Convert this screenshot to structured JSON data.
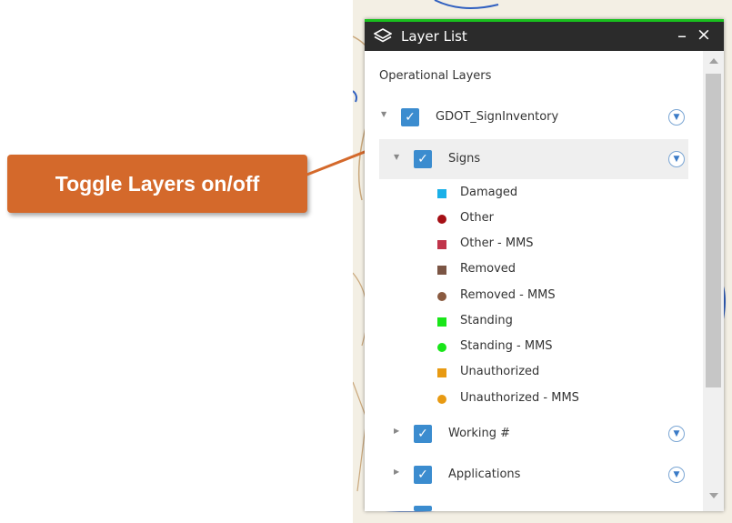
{
  "callout": {
    "text": "Toggle Layers on/off"
  },
  "panel": {
    "title": "Layer List",
    "minimize_label": "–",
    "close_label": "×",
    "section_title": "Operational Layers"
  },
  "layers": [
    {
      "label": "GDOT_SignInventory",
      "checked": true,
      "expanded": true
    },
    {
      "label": "Signs",
      "checked": true,
      "expanded": true,
      "selected": true
    },
    {
      "label": "Working #",
      "checked": true,
      "expanded": false
    },
    {
      "label": "Applications",
      "checked": true,
      "expanded": false
    }
  ],
  "legend": [
    {
      "label": "Damaged",
      "color": "#1ab0e8",
      "shape": "square"
    },
    {
      "label": "Other",
      "color": "#a50f15",
      "shape": "circle"
    },
    {
      "label": "Other - MMS",
      "color": "#c0344a",
      "shape": "square"
    },
    {
      "label": "Removed",
      "color": "#7b5544",
      "shape": "square"
    },
    {
      "label": "Removed - MMS",
      "color": "#8a5a40",
      "shape": "circle"
    },
    {
      "label": "Standing",
      "color": "#19e619",
      "shape": "square"
    },
    {
      "label": "Standing - MMS",
      "color": "#19e619",
      "shape": "circle"
    },
    {
      "label": "Unauthorized",
      "color": "#e89a12",
      "shape": "square"
    },
    {
      "label": "Unauthorized - MMS",
      "color": "#e89a12",
      "shape": "circle"
    }
  ],
  "colors": {
    "callout_bg": "#d4692b",
    "header_bg": "#2b2b2b",
    "accent_green": "#19c01e",
    "checkbox_blue": "#3b8ccf",
    "arrow": "#d4692b"
  },
  "icons": {
    "layers": "layers-icon",
    "checkbox": "checkmark-icon",
    "expand": "triangle-down-icon",
    "collapse": "triangle-right-icon",
    "options": "chevron-down-circle-icon"
  }
}
